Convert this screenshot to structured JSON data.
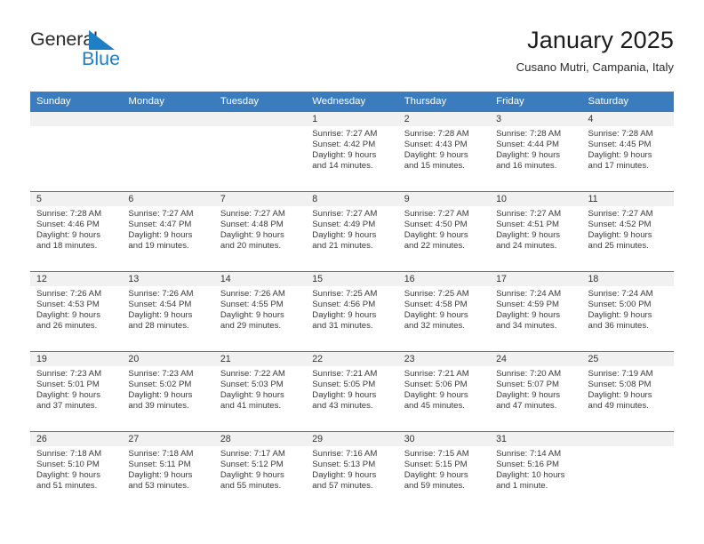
{
  "brand": {
    "word1": "General",
    "word2": "Blue",
    "triangle_icon": "blue-triangle-icon",
    "color_dark": "#2b2b2b",
    "color_blue": "#1f7fc4"
  },
  "header": {
    "title": "January 2025",
    "subtitle": "Cusano Mutri, Campania, Italy"
  },
  "theme": {
    "header_blue": "#3a7cbd",
    "daynum_gray": "#f1f1f1",
    "text": "#3a3a3a"
  },
  "calendar": {
    "weekday_headers": [
      "Sunday",
      "Monday",
      "Tuesday",
      "Wednesday",
      "Thursday",
      "Friday",
      "Saturday"
    ],
    "weeks": [
      [
        {
          "day": "",
          "sunrise": "",
          "sunset": "",
          "daylight1": "",
          "daylight2": ""
        },
        {
          "day": "",
          "sunrise": "",
          "sunset": "",
          "daylight1": "",
          "daylight2": ""
        },
        {
          "day": "",
          "sunrise": "",
          "sunset": "",
          "daylight1": "",
          "daylight2": ""
        },
        {
          "day": "1",
          "sunrise": "Sunrise: 7:27 AM",
          "sunset": "Sunset: 4:42 PM",
          "daylight1": "Daylight: 9 hours",
          "daylight2": "and 14 minutes."
        },
        {
          "day": "2",
          "sunrise": "Sunrise: 7:28 AM",
          "sunset": "Sunset: 4:43 PM",
          "daylight1": "Daylight: 9 hours",
          "daylight2": "and 15 minutes."
        },
        {
          "day": "3",
          "sunrise": "Sunrise: 7:28 AM",
          "sunset": "Sunset: 4:44 PM",
          "daylight1": "Daylight: 9 hours",
          "daylight2": "and 16 minutes."
        },
        {
          "day": "4",
          "sunrise": "Sunrise: 7:28 AM",
          "sunset": "Sunset: 4:45 PM",
          "daylight1": "Daylight: 9 hours",
          "daylight2": "and 17 minutes."
        }
      ],
      [
        {
          "day": "5",
          "sunrise": "Sunrise: 7:28 AM",
          "sunset": "Sunset: 4:46 PM",
          "daylight1": "Daylight: 9 hours",
          "daylight2": "and 18 minutes."
        },
        {
          "day": "6",
          "sunrise": "Sunrise: 7:27 AM",
          "sunset": "Sunset: 4:47 PM",
          "daylight1": "Daylight: 9 hours",
          "daylight2": "and 19 minutes."
        },
        {
          "day": "7",
          "sunrise": "Sunrise: 7:27 AM",
          "sunset": "Sunset: 4:48 PM",
          "daylight1": "Daylight: 9 hours",
          "daylight2": "and 20 minutes."
        },
        {
          "day": "8",
          "sunrise": "Sunrise: 7:27 AM",
          "sunset": "Sunset: 4:49 PM",
          "daylight1": "Daylight: 9 hours",
          "daylight2": "and 21 minutes."
        },
        {
          "day": "9",
          "sunrise": "Sunrise: 7:27 AM",
          "sunset": "Sunset: 4:50 PM",
          "daylight1": "Daylight: 9 hours",
          "daylight2": "and 22 minutes."
        },
        {
          "day": "10",
          "sunrise": "Sunrise: 7:27 AM",
          "sunset": "Sunset: 4:51 PM",
          "daylight1": "Daylight: 9 hours",
          "daylight2": "and 24 minutes."
        },
        {
          "day": "11",
          "sunrise": "Sunrise: 7:27 AM",
          "sunset": "Sunset: 4:52 PM",
          "daylight1": "Daylight: 9 hours",
          "daylight2": "and 25 minutes."
        }
      ],
      [
        {
          "day": "12",
          "sunrise": "Sunrise: 7:26 AM",
          "sunset": "Sunset: 4:53 PM",
          "daylight1": "Daylight: 9 hours",
          "daylight2": "and 26 minutes."
        },
        {
          "day": "13",
          "sunrise": "Sunrise: 7:26 AM",
          "sunset": "Sunset: 4:54 PM",
          "daylight1": "Daylight: 9 hours",
          "daylight2": "and 28 minutes."
        },
        {
          "day": "14",
          "sunrise": "Sunrise: 7:26 AM",
          "sunset": "Sunset: 4:55 PM",
          "daylight1": "Daylight: 9 hours",
          "daylight2": "and 29 minutes."
        },
        {
          "day": "15",
          "sunrise": "Sunrise: 7:25 AM",
          "sunset": "Sunset: 4:56 PM",
          "daylight1": "Daylight: 9 hours",
          "daylight2": "and 31 minutes."
        },
        {
          "day": "16",
          "sunrise": "Sunrise: 7:25 AM",
          "sunset": "Sunset: 4:58 PM",
          "daylight1": "Daylight: 9 hours",
          "daylight2": "and 32 minutes."
        },
        {
          "day": "17",
          "sunrise": "Sunrise: 7:24 AM",
          "sunset": "Sunset: 4:59 PM",
          "daylight1": "Daylight: 9 hours",
          "daylight2": "and 34 minutes."
        },
        {
          "day": "18",
          "sunrise": "Sunrise: 7:24 AM",
          "sunset": "Sunset: 5:00 PM",
          "daylight1": "Daylight: 9 hours",
          "daylight2": "and 36 minutes."
        }
      ],
      [
        {
          "day": "19",
          "sunrise": "Sunrise: 7:23 AM",
          "sunset": "Sunset: 5:01 PM",
          "daylight1": "Daylight: 9 hours",
          "daylight2": "and 37 minutes."
        },
        {
          "day": "20",
          "sunrise": "Sunrise: 7:23 AM",
          "sunset": "Sunset: 5:02 PM",
          "daylight1": "Daylight: 9 hours",
          "daylight2": "and 39 minutes."
        },
        {
          "day": "21",
          "sunrise": "Sunrise: 7:22 AM",
          "sunset": "Sunset: 5:03 PM",
          "daylight1": "Daylight: 9 hours",
          "daylight2": "and 41 minutes."
        },
        {
          "day": "22",
          "sunrise": "Sunrise: 7:21 AM",
          "sunset": "Sunset: 5:05 PM",
          "daylight1": "Daylight: 9 hours",
          "daylight2": "and 43 minutes."
        },
        {
          "day": "23",
          "sunrise": "Sunrise: 7:21 AM",
          "sunset": "Sunset: 5:06 PM",
          "daylight1": "Daylight: 9 hours",
          "daylight2": "and 45 minutes."
        },
        {
          "day": "24",
          "sunrise": "Sunrise: 7:20 AM",
          "sunset": "Sunset: 5:07 PM",
          "daylight1": "Daylight: 9 hours",
          "daylight2": "and 47 minutes."
        },
        {
          "day": "25",
          "sunrise": "Sunrise: 7:19 AM",
          "sunset": "Sunset: 5:08 PM",
          "daylight1": "Daylight: 9 hours",
          "daylight2": "and 49 minutes."
        }
      ],
      [
        {
          "day": "26",
          "sunrise": "Sunrise: 7:18 AM",
          "sunset": "Sunset: 5:10 PM",
          "daylight1": "Daylight: 9 hours",
          "daylight2": "and 51 minutes."
        },
        {
          "day": "27",
          "sunrise": "Sunrise: 7:18 AM",
          "sunset": "Sunset: 5:11 PM",
          "daylight1": "Daylight: 9 hours",
          "daylight2": "and 53 minutes."
        },
        {
          "day": "28",
          "sunrise": "Sunrise: 7:17 AM",
          "sunset": "Sunset: 5:12 PM",
          "daylight1": "Daylight: 9 hours",
          "daylight2": "and 55 minutes."
        },
        {
          "day": "29",
          "sunrise": "Sunrise: 7:16 AM",
          "sunset": "Sunset: 5:13 PM",
          "daylight1": "Daylight: 9 hours",
          "daylight2": "and 57 minutes."
        },
        {
          "day": "30",
          "sunrise": "Sunrise: 7:15 AM",
          "sunset": "Sunset: 5:15 PM",
          "daylight1": "Daylight: 9 hours",
          "daylight2": "and 59 minutes."
        },
        {
          "day": "31",
          "sunrise": "Sunrise: 7:14 AM",
          "sunset": "Sunset: 5:16 PM",
          "daylight1": "Daylight: 10 hours",
          "daylight2": "and 1 minute."
        },
        {
          "day": "",
          "sunrise": "",
          "sunset": "",
          "daylight1": "",
          "daylight2": ""
        }
      ]
    ]
  }
}
